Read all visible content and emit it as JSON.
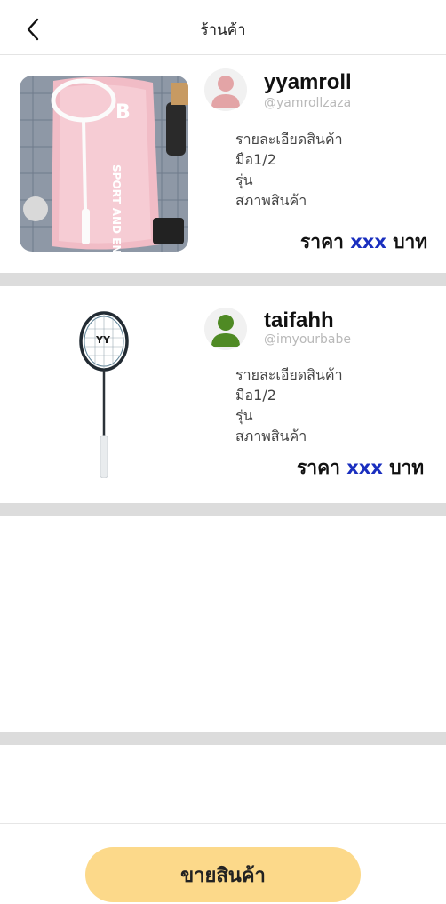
{
  "header": {
    "title": "ร้านค้า",
    "back_icon": "chevron-left-icon"
  },
  "listings": [
    {
      "seller_name": "yyamroll",
      "seller_handle": "@yamrollzaza",
      "avatar_color": "#e3a4a6",
      "details": [
        "รายละเอียดสินค้า",
        "มือ1/2",
        "รุ่น",
        "สภาพสินค้า"
      ],
      "price_label": "ราคา",
      "price_value": "xxx",
      "price_unit": "บาท"
    },
    {
      "seller_name": "taifahh",
      "seller_handle": "@imyourbabe",
      "avatar_color": "#4f8a24",
      "details": [
        "รายละเอียดสินค้า",
        "มือ1/2",
        "รุ่น",
        "สภาพสินค้า"
      ],
      "price_label": "ราคา",
      "price_value": "xxx",
      "price_unit": "บาท"
    }
  ],
  "bottom": {
    "sell_button_label": "ขายสินค้า"
  },
  "colors": {
    "accent_button": "#fcd98a",
    "price_accent": "#1a2fbf",
    "divider": "#dcdcdc"
  }
}
